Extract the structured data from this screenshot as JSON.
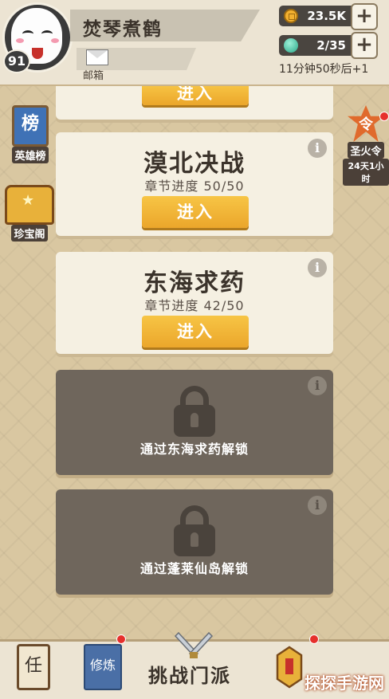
{
  "player": {
    "name": "焚琴煮鹤",
    "level": "91",
    "mail_label": "邮箱"
  },
  "resources": {
    "coins": "23.5K",
    "energy": "2/35",
    "timer": "11分钟50秒后+1"
  },
  "side_left": [
    {
      "label": "英雄榜",
      "icon": "榜"
    },
    {
      "label": "珍宝阁"
    }
  ],
  "side_right": {
    "label": "圣火令",
    "sub": "24天1小时",
    "icon": "令"
  },
  "partial_card": {
    "button": "进入"
  },
  "cards": [
    {
      "title": "漠北决战",
      "progress": "章节进度 50/50",
      "button": "进入"
    },
    {
      "title": "东海求药",
      "progress": "章节进度 42/50",
      "button": "进入"
    }
  ],
  "locked_cards": [
    {
      "text": "通过东海求药解锁"
    },
    {
      "text": "通过蓬莱仙岛解锁"
    }
  ],
  "info_symbol": "i",
  "bottom_nav": {
    "task_icon": "任",
    "train_icon": "修炼",
    "challenge_label": "挑战门派"
  },
  "watermark": "探探手游网",
  "colors": {
    "accent": "#f0b338",
    "locked": "#6f665c",
    "badge": "#e6302c"
  }
}
